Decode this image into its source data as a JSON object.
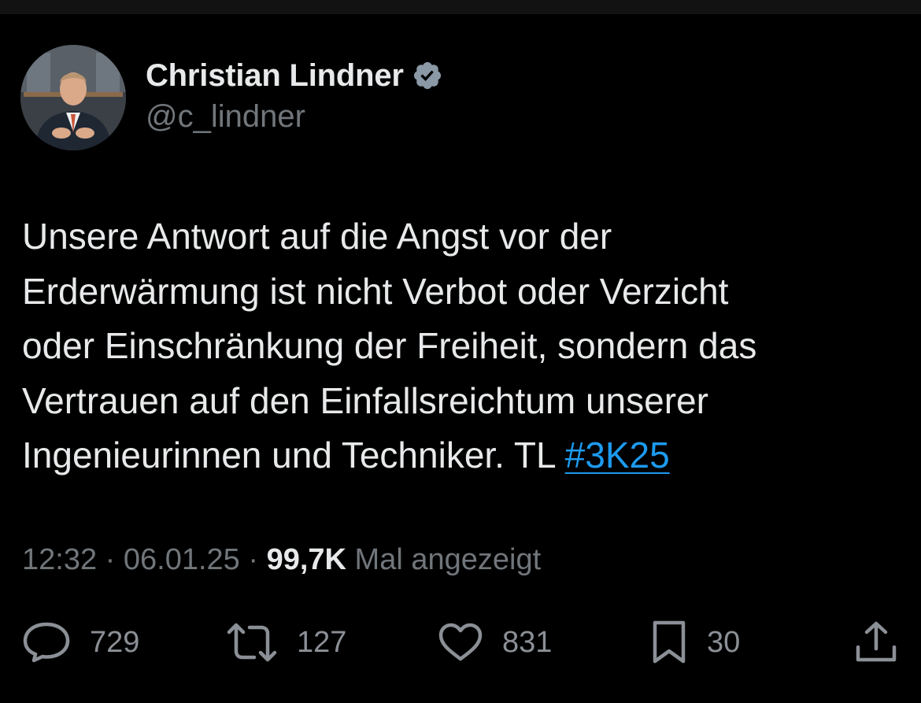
{
  "author": {
    "display_name": "Christian Lindner",
    "handle": "@c_lindner",
    "verified": true,
    "verified_icon": "verified-badge-icon"
  },
  "tweet": {
    "lines": [
      "Unsere Antwort auf die Angst vor der",
      "Erderwärmung ist nicht Verbot oder Verzicht",
      "oder Einschränkung der Freiheit, sondern das",
      "Vertrauen auf den Einfallsreichtum unserer",
      "Ingenieurinnen und Techniker. TL "
    ],
    "hashtag": "#3K25"
  },
  "meta": {
    "time": "12:32",
    "separator": " · ",
    "date": "06.01.25",
    "views_count": "99,7K",
    "views_label": " Mal angezeigt"
  },
  "actions": {
    "replies": {
      "icon": "reply-icon",
      "count": "729"
    },
    "retweets": {
      "icon": "retweet-icon",
      "count": "127"
    },
    "likes": {
      "icon": "heart-icon",
      "count": "831"
    },
    "bookmarks": {
      "icon": "bookmark-icon",
      "count": "30"
    },
    "share": {
      "icon": "share-icon"
    }
  },
  "colors": {
    "background": "#000000",
    "text": "#e7e9ea",
    "secondary_text": "#71767b",
    "link": "#1d9bf0",
    "verified_badge": "#8b98a5"
  }
}
